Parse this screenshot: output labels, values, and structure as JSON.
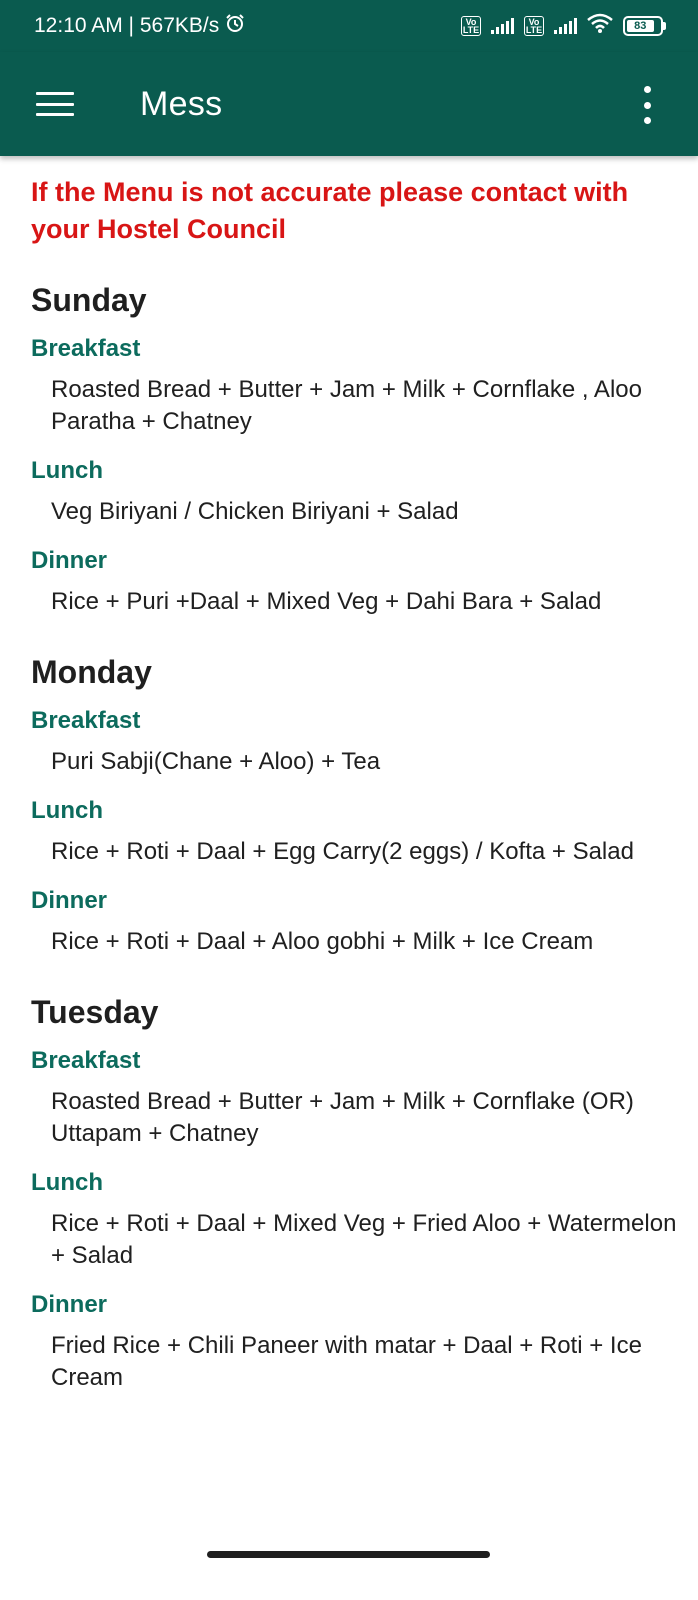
{
  "status_bar": {
    "time_speed": "12:10 AM | 567KB/s",
    "alarm_icon": "alarm-icon",
    "sim_badge": "Vo LTE",
    "battery_level": "83"
  },
  "app_bar": {
    "title": "Mess",
    "menu_icon": "hamburger-menu-icon",
    "overflow_icon": "more-vert-icon"
  },
  "notice": "If the Menu is not accurate please contact with your Hostel Council",
  "days": [
    {
      "name": "Sunday",
      "meals": [
        {
          "label": "Breakfast",
          "items": "Roasted Bread + Butter + Jam + Milk + Cornflake , Aloo Paratha + Chatney"
        },
        {
          "label": "Lunch",
          "items": "Veg Biriyani / Chicken Biriyani + Salad"
        },
        {
          "label": "Dinner",
          "items": "Rice + Puri +Daal + Mixed Veg + Dahi Bara + Salad"
        }
      ]
    },
    {
      "name": "Monday",
      "meals": [
        {
          "label": "Breakfast",
          "items": "Puri Sabji(Chane + Aloo) + Tea"
        },
        {
          "label": "Lunch",
          "items": "Rice + Roti + Daal + Egg Carry(2 eggs) / Kofta + Salad"
        },
        {
          "label": "Dinner",
          "items": "Rice + Roti + Daal + Aloo gobhi + Milk + Ice Cream"
        }
      ]
    },
    {
      "name": "Tuesday",
      "meals": [
        {
          "label": "Breakfast",
          "items": "Roasted Bread + Butter + Jam + Milk + Cornflake (OR) Uttapam + Chatney"
        },
        {
          "label": "Lunch",
          "items": "Rice + Roti + Daal + Mixed Veg + Fried Aloo + Watermelon + Salad"
        },
        {
          "label": "Dinner",
          "items": "Fried Rice + Chili Paneer with matar + Daal + Roti + Ice Cream"
        }
      ]
    }
  ],
  "colors": {
    "primary": "#0a5b4f",
    "notice": "#d81515",
    "meal_label": "#0c6b5d"
  }
}
